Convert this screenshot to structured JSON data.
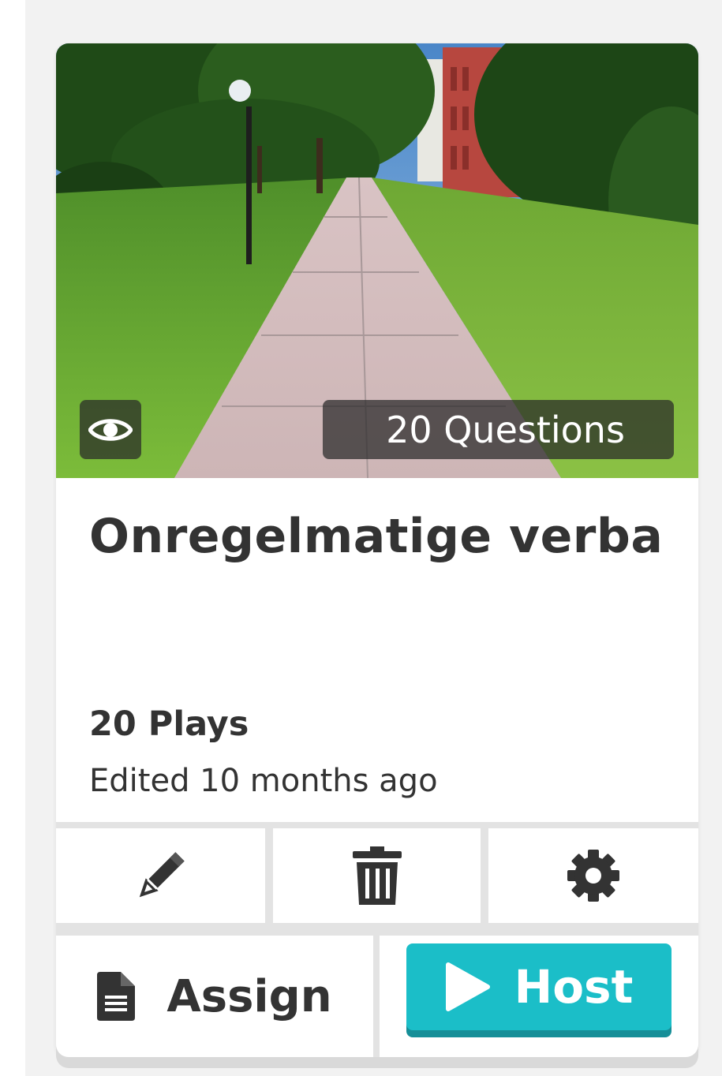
{
  "quiz": {
    "title": "Onregelmatige verba",
    "questions_badge": "20 Questions",
    "plays": "20 Plays",
    "edited": "Edited 10 months ago"
  },
  "actions": {
    "edit_icon": "pencil-icon",
    "delete_icon": "trash-icon",
    "settings_icon": "gear-icon",
    "preview_icon": "eye-icon"
  },
  "buttons": {
    "assign_label": "Assign",
    "assign_icon": "document-icon",
    "host_label": "Host",
    "host_icon": "play-icon"
  },
  "colors": {
    "host_button": "#1bbec8",
    "host_button_shadow": "#168f98",
    "text": "#333333"
  }
}
